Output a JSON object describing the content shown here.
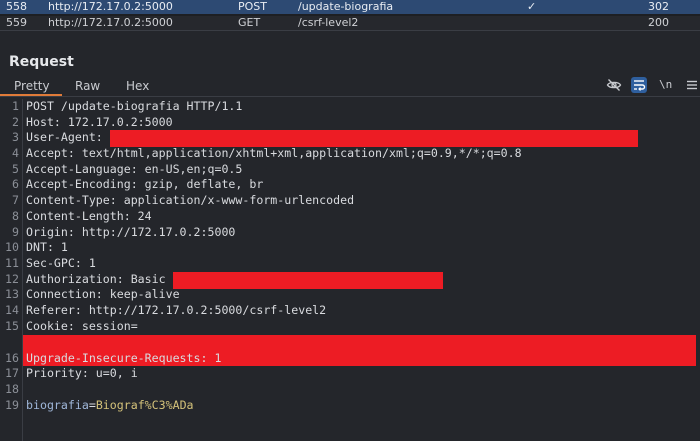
{
  "history": [
    {
      "num": "558",
      "host": "http://172.17.0.2:5000",
      "method": "POST",
      "path": "/update-biografia",
      "check": "✓",
      "status": "302"
    },
    {
      "num": "559",
      "host": "http://172.17.0.2:5000",
      "method": "GET",
      "path": "/csrf-level2",
      "check": "",
      "status": "200"
    }
  ],
  "panel": {
    "title": "Request",
    "tabs": [
      "Pretty",
      "Raw",
      "Hex"
    ],
    "active_tab": "Pretty",
    "toolbar": {
      "newline_label": "\\n"
    }
  },
  "request_lines": [
    {
      "n": "1",
      "text": "POST /update-biografia HTTP/1.1"
    },
    {
      "n": "2",
      "text": "Host: 172.17.0.2:5000"
    },
    {
      "n": "3",
      "text": "User-Agent: "
    },
    {
      "n": "4",
      "text": "Accept: text/html,application/xhtml+xml,application/xml;q=0.9,*/*;q=0.8"
    },
    {
      "n": "5",
      "text": "Accept-Language: en-US,en;q=0.5"
    },
    {
      "n": "6",
      "text": "Accept-Encoding: gzip, deflate, br"
    },
    {
      "n": "7",
      "text": "Content-Type: application/x-www-form-urlencoded"
    },
    {
      "n": "8",
      "text": "Content-Length: 24"
    },
    {
      "n": "9",
      "text": "Origin: http://172.17.0.2:5000"
    },
    {
      "n": "10",
      "text": "DNT: 1"
    },
    {
      "n": "11",
      "text": "Sec-GPC: 1"
    },
    {
      "n": "12",
      "text": "Authorization: Basic "
    },
    {
      "n": "13",
      "text": "Connection: keep-alive"
    },
    {
      "n": "14",
      "text": "Referer: http://172.17.0.2:5000/csrf-level2"
    },
    {
      "n": "15",
      "text": "Cookie: session="
    },
    {
      "n": "16",
      "text": "Upgrade-Insecure-Requests: 1"
    },
    {
      "n": "17",
      "text": "Priority: u=0, i"
    },
    {
      "n": "18",
      "text": ""
    },
    {
      "n": "19",
      "text": ""
    }
  ],
  "body_param": {
    "name": "biografia",
    "eq": "=",
    "value": "Biograf%C3%ADa"
  },
  "colors": {
    "selected_row": "#2d4a73",
    "redaction": "#ed1c24",
    "tab_accent": "#e07b39"
  }
}
